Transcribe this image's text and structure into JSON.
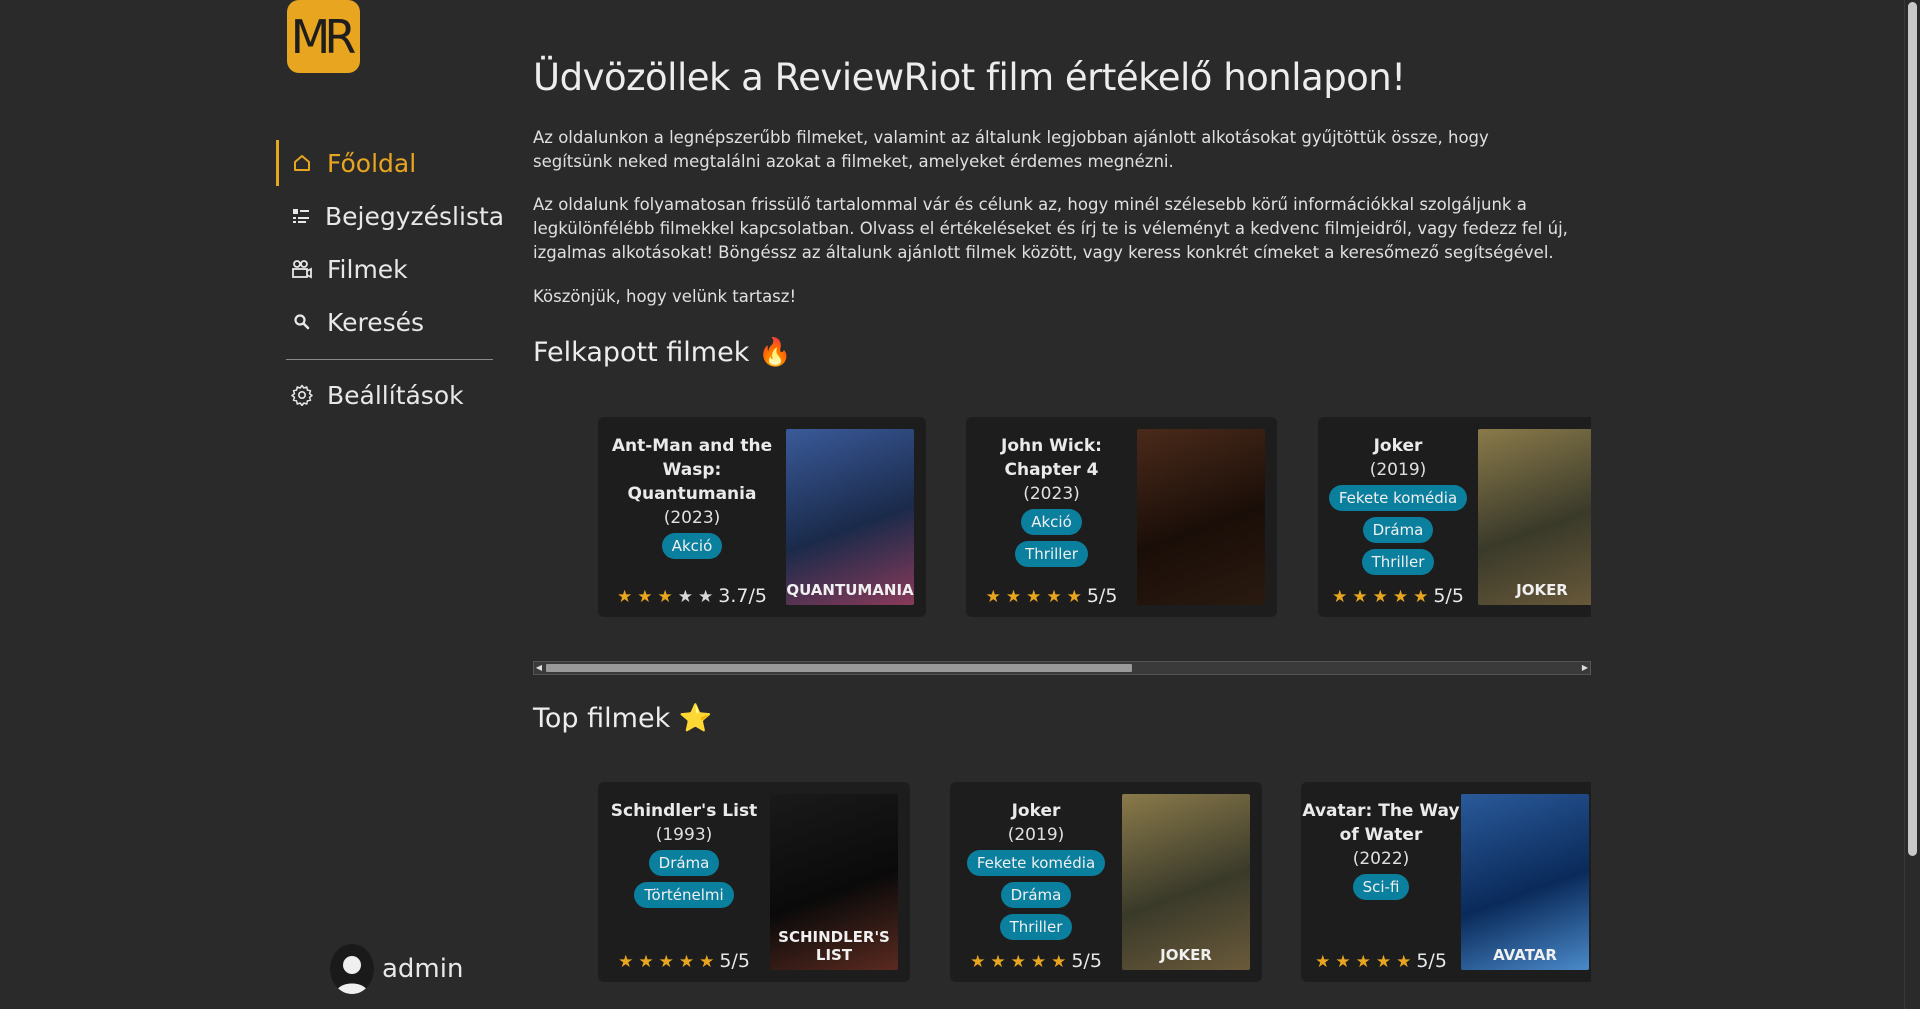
{
  "logo": {
    "text": "MR"
  },
  "nav": {
    "items": [
      {
        "label": "Főoldal",
        "icon": "home-icon",
        "active": true
      },
      {
        "label": "Bejegyzéslista",
        "icon": "list-icon",
        "active": false
      },
      {
        "label": "Filmek",
        "icon": "film-camera-icon",
        "active": false
      },
      {
        "label": "Keresés",
        "icon": "search-icon",
        "active": false
      }
    ],
    "settings": {
      "label": "Beállítások",
      "icon": "gear-icon"
    }
  },
  "user": {
    "name": "admin"
  },
  "main": {
    "title": "Üdvözöllek a ReviewRiot film értékelő honlapon!",
    "paragraphs": [
      "Az oldalunkon a legnépszerűbb filmeket, valamint az általunk legjobban ajánlott alkotásokat gyűjtöttük össze, hogy segítsünk neked megtalálni azokat a filmeket, amelyeket érdemes megnézni.",
      "Az oldalunk folyamatosan frissülő tartalommal vár és célunk az, hogy minél szélesebb körű információkkal szolgáljunk a legkülönfélébb filmekkel kapcsolatban. Olvass el értékeléseket és írj te is véleményt a kedvenc filmjeidről, vagy fedezz fel új, izgalmas alkotásokat! Böngéssz az általunk ajánlott filmek között, vagy keress konkrét címeket a keresőmező segítségével.",
      "Köszönjük, hogy velünk tartasz!"
    ],
    "trending": {
      "heading": "Felkapott filmek",
      "emoji": "🔥",
      "cards": [
        {
          "title": "Ant-Man and the Wasp: Quantumania",
          "year": "(2023)",
          "tags": [
            "Akció"
          ],
          "rating": 3.7,
          "rating_text": "3.7/5",
          "poster_label": "QUANTUMANIA",
          "poster_colors": [
            "#3a5a9a",
            "#1a2a4a",
            "#8a3a5a"
          ]
        },
        {
          "title": "John Wick: Chapter 4",
          "year": "(2023)",
          "tags": [
            "Akció",
            "Thriller"
          ],
          "rating": 5,
          "rating_text": "5/5",
          "poster_label": "",
          "poster_colors": [
            "#4a2a1a",
            "#1a0e08",
            "#2a1a10"
          ]
        },
        {
          "title": "Joker",
          "year": "(2019)",
          "tags": [
            "Fekete komédia",
            "Dráma",
            "Thriller"
          ],
          "rating": 5,
          "rating_text": "5/5",
          "poster_label": "JOKER",
          "poster_colors": [
            "#8a7a4a",
            "#3a3a2a",
            "#6a5a3a"
          ]
        }
      ]
    },
    "top": {
      "heading": "Top filmek",
      "emoji": "⭐",
      "cards": [
        {
          "title": "Schindler's List",
          "year": "(1993)",
          "tags": [
            "Dráma",
            "Történelmi"
          ],
          "rating": 5,
          "rating_text": "5/5",
          "poster_label": "SCHINDLER'S LIST",
          "poster_colors": [
            "#1a1a1a",
            "#0a0a0a",
            "#5a2a20"
          ]
        },
        {
          "title": "Joker",
          "year": "(2019)",
          "tags": [
            "Fekete komédia",
            "Dráma",
            "Thriller"
          ],
          "rating": 5,
          "rating_text": "5/5",
          "poster_label": "JOKER",
          "poster_colors": [
            "#8a7a4a",
            "#3a3a2a",
            "#6a5a3a"
          ]
        },
        {
          "title": "Avatar: The Way of Water",
          "year": "(2022)",
          "tags": [
            "Sci-fi"
          ],
          "rating": 5,
          "rating_text": "5/5",
          "poster_label": "AVATAR",
          "poster_colors": [
            "#2a5a9a",
            "#0a2a5a",
            "#4a8aca"
          ]
        }
      ]
    }
  },
  "colors": {
    "accent": "#e8a520",
    "tag": "#0b7f9e",
    "card": "#1d1d1d",
    "background": "#2a2a2a"
  }
}
